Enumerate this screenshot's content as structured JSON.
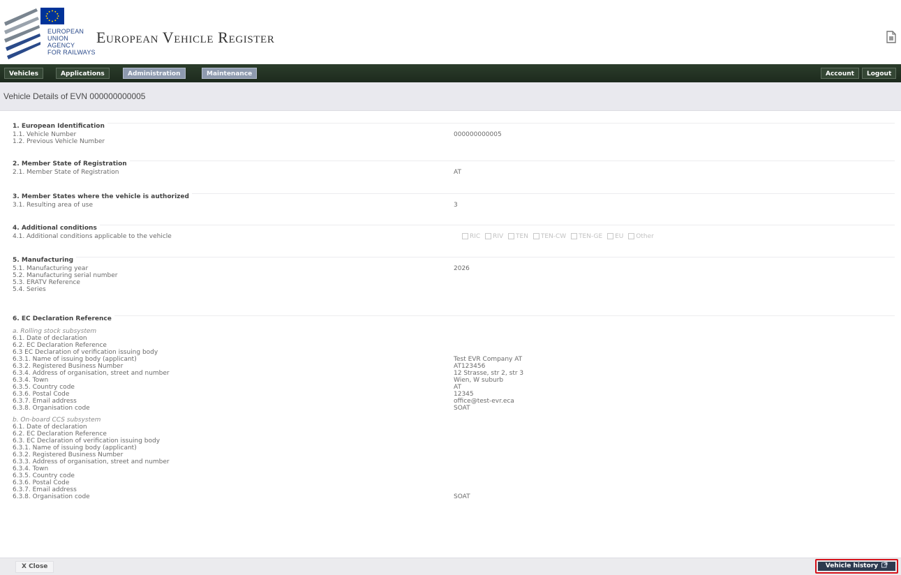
{
  "header": {
    "agency_lines": [
      "EUROPEAN",
      "UNION",
      "AGENCY",
      "FOR RAILWAYS"
    ],
    "app_title": "European Vehicle Register",
    "doc_icon": "document-icon",
    "flag_color": "#003399"
  },
  "nav": {
    "left": [
      "Vehicles",
      "Applications",
      "Administration",
      "Maintenance"
    ],
    "right": [
      "Account",
      "Logout"
    ]
  },
  "page_title": "Vehicle Details of EVN 000000000005",
  "sections": {
    "s1": {
      "title": "1. European Identification",
      "rows": [
        {
          "label": "1.1. Vehicle Number",
          "value": "000000000005"
        },
        {
          "label": "1.2. Previous Vehicle Number",
          "value": ""
        }
      ]
    },
    "s2": {
      "title": "2. Member State of Registration",
      "rows": [
        {
          "label": "2.1. Member State of Registration",
          "value": "AT"
        }
      ]
    },
    "s3": {
      "title": "3. Member States where the vehicle is authorized",
      "rows": [
        {
          "label": "3.1. Resulting area of use",
          "value": "3"
        }
      ]
    },
    "s4": {
      "title": "4. Additional conditions",
      "rows": [
        {
          "label": "4.1. Additional conditions applicable to the vehicle",
          "value": ""
        }
      ],
      "checkboxes": [
        "RIC",
        "RIV",
        "TEN",
        "TEN-CW",
        "TEN-GE",
        "EU",
        "Other"
      ]
    },
    "s5": {
      "title": "5. Manufacturing",
      "rows": [
        {
          "label": "5.1. Manufacturing year",
          "value": "2026"
        },
        {
          "label": "5.2. Manufacturing serial number",
          "value": ""
        },
        {
          "label": "5.3. ERATV Reference",
          "value": ""
        },
        {
          "label": "5.4. Series",
          "value": ""
        }
      ]
    },
    "s6": {
      "title": "6. EC Declaration Reference",
      "a_title": "a. Rolling stock subsystem",
      "a_rows": [
        {
          "label": "6.1. Date of declaration",
          "value": ""
        },
        {
          "label": "6.2. EC Declaration Reference",
          "value": ""
        },
        {
          "label": "6.3 EC Declaration of verification issuing body",
          "value": ""
        },
        {
          "label": "6.3.1. Name of issuing body (applicant)",
          "value": "Test EVR Company AT"
        },
        {
          "label": "6.3.2. Registered Business Number",
          "value": "AT123456"
        },
        {
          "label": "6.3.4. Address of organisation, street and number",
          "value": "12 Strasse, str 2, str 3"
        },
        {
          "label": "6.3.4. Town",
          "value": "Wien, W suburb"
        },
        {
          "label": "6.3.5. Country code",
          "value": "AT"
        },
        {
          "label": "6.3.6. Postal Code",
          "value": "12345"
        },
        {
          "label": "6.3.7. Email address",
          "value": "office@test-evr.eca"
        },
        {
          "label": "6.3.8. Organisation code",
          "value": "SOAT"
        }
      ],
      "b_title": "b. On-board CCS subsystem",
      "b_rows": [
        {
          "label": "6.1. Date of declaration",
          "value": ""
        },
        {
          "label": "6.2. EC Declaration Reference",
          "value": ""
        },
        {
          "label": "6.3. EC Declaration of verification issuing body",
          "value": ""
        },
        {
          "label": "6.3.1. Name of issuing body (applicant)",
          "value": ""
        },
        {
          "label": "6.3.2. Registered Business Number",
          "value": ""
        },
        {
          "label": "6.3.3. Address of organisation, street and number",
          "value": ""
        },
        {
          "label": "6.3.4. Town",
          "value": ""
        },
        {
          "label": "6.3.5. Country code",
          "value": ""
        },
        {
          "label": "6.3.6. Postal Code",
          "value": ""
        },
        {
          "label": "6.3.7. Email address",
          "value": ""
        },
        {
          "label": "6.3.8. Organisation code",
          "value": "SOAT"
        }
      ]
    }
  },
  "footer": {
    "close_label": "X Close",
    "history_label": "Vehicle history",
    "history_icon": "external-link-icon",
    "highlight_color": "#d6121a"
  }
}
